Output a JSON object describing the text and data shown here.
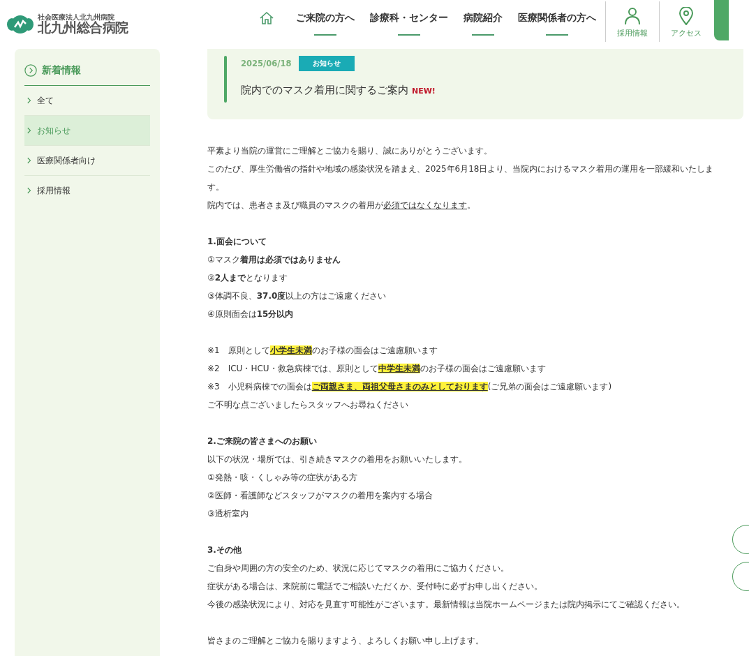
{
  "header": {
    "logo": {
      "subtitle": "社会医療法人北九州病院",
      "name": "北九州総合病院"
    },
    "nav": [
      {
        "label": "ご来院の方へ"
      },
      {
        "label": "診療科・センター"
      },
      {
        "label": "病院紹介"
      },
      {
        "label": "医療関係者の方へ"
      }
    ],
    "utilities": [
      {
        "label": "採用情報",
        "kind": "person"
      },
      {
        "label": "アクセス",
        "kind": "pin"
      }
    ]
  },
  "sidebar": {
    "title": "新着情報",
    "items": [
      {
        "label": "全て",
        "selected": false
      },
      {
        "label": "お知らせ",
        "selected": true
      },
      {
        "label": "医療関係者向け",
        "selected": false
      },
      {
        "label": "採用情報",
        "selected": false
      }
    ]
  },
  "article": {
    "date": "2025/06/18",
    "category": "お知らせ",
    "title": "院内でのマスク着用に関するご案内",
    "badge": "NEW!",
    "body": [
      [
        [
          {
            "text": "平素より当院の運営にご理解とご協力を賜り、誠にありがとうございます。",
            "kind": "plain"
          }
        ],
        [
          {
            "text": "このたび、厚生労働省の指針や地域の感染状況を踏まえ、2025年6月18日より、当院内におけるマスク着用の運用を一部緩和いたします。",
            "kind": "plain"
          }
        ],
        [
          {
            "text": "院内では、患者さま及び職員のマスクの着用が",
            "kind": "plain"
          },
          {
            "text": "必須ではなくなります",
            "kind": "underline"
          },
          {
            "text": "。",
            "kind": "plain"
          }
        ]
      ],
      [
        [
          {
            "text": "1.面会について",
            "kind": "bold"
          }
        ],
        [
          {
            "text": "①マスク",
            "kind": "plain"
          },
          {
            "text": "着用は必須ではありません",
            "kind": "bold"
          }
        ],
        [
          {
            "text": "②",
            "kind": "plain"
          },
          {
            "text": "2人まで",
            "kind": "bold"
          },
          {
            "text": "となります",
            "kind": "plain"
          }
        ],
        [
          {
            "text": "③体調不良、",
            "kind": "plain"
          },
          {
            "text": "37.0度",
            "kind": "bold"
          },
          {
            "text": "以上の方はご遠慮ください",
            "kind": "plain"
          }
        ],
        [
          {
            "text": "④原則面会は",
            "kind": "plain"
          },
          {
            "text": "15分以内",
            "kind": "bold"
          }
        ]
      ],
      [
        [
          {
            "text": "※1　原則として",
            "kind": "plain"
          },
          {
            "text": "小学生未満",
            "kind": "highlight"
          },
          {
            "text": "のお子様の面会はご遠慮願います",
            "kind": "plain"
          }
        ],
        [
          {
            "text": "※2　ICU・HCU・救急病棟では、原則として",
            "kind": "plain"
          },
          {
            "text": "中学生未満",
            "kind": "highlight"
          },
          {
            "text": "のお子様の面会はご遠慮願います",
            "kind": "plain"
          }
        ],
        [
          {
            "text": "※3　小児科病棟での面会は",
            "kind": "plain"
          },
          {
            "text": "ご両親さま、両祖父母さまのみとしております",
            "kind": "highlight"
          },
          {
            "text": "(ご兄弟の面会はご遠慮願います)",
            "kind": "plain"
          }
        ],
        [
          {
            "text": "ご不明な点ございましたらスタッフへお尋ねください",
            "kind": "plain"
          }
        ]
      ],
      [
        [
          {
            "text": "2.ご来院の皆さまへのお願い",
            "kind": "bold"
          }
        ],
        [
          {
            "text": "以下の状況・場所では、引き続きマスクの着用をお願いいたします。",
            "kind": "plain"
          }
        ],
        [
          {
            "text": "①発熱・咳・くしゃみ等の症状がある方",
            "kind": "plain"
          }
        ],
        [
          {
            "text": "②医師・看護師などスタッフがマスクの着用を案内する場合",
            "kind": "plain"
          }
        ],
        [
          {
            "text": "③透析室内",
            "kind": "plain"
          }
        ]
      ],
      [
        [
          {
            "text": "3.その他",
            "kind": "bold"
          }
        ],
        [
          {
            "text": "ご自身や周囲の方の安全のため、状況に応じてマスクの着用にご協力ください。",
            "kind": "plain"
          }
        ],
        [
          {
            "text": "症状がある場合は、来院前に電話でご相談いただくか、受付時に必ずお申し出ください。",
            "kind": "plain"
          }
        ],
        [
          {
            "text": "今後の感染状況により、対応を見直す可能性がございます。最新情報は当院ホームページまたは院内掲示にてご確認ください。",
            "kind": "plain"
          }
        ]
      ],
      [
        [
          {
            "text": "皆さまのご理解とご協力を賜りますよう、よろしくお願い申し上げます。",
            "kind": "plain"
          }
        ]
      ]
    ]
  }
}
